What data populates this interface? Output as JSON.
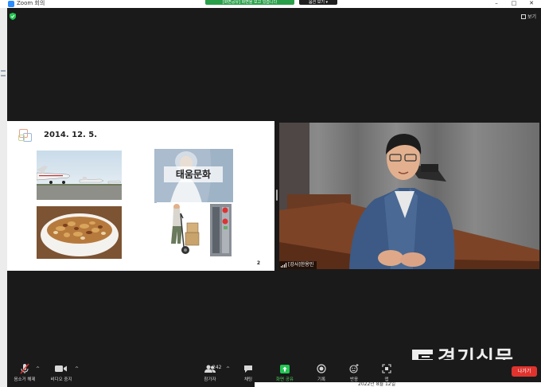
{
  "window": {
    "title": "Zoom 회의",
    "share_banner": "[화면공유] 화면을 보고 있습니다",
    "stop_share_label": "옵션 보기 ▾",
    "controls": {
      "minimize": "–",
      "maximize": "□",
      "close": "✕"
    }
  },
  "top_overlay": {
    "view_label": "보기",
    "security_icon": "shield-check-icon"
  },
  "slide": {
    "date": "2014. 12. 5.",
    "culture_caption": "태움문화",
    "page_number": "2"
  },
  "video": {
    "participant_name": "[강사]한용민"
  },
  "toolbar": {
    "mute_label": "음소거 해제",
    "video_label": "비디오 중지",
    "participants_label": "참가자",
    "participants_count": "242",
    "chat_label": "채팅",
    "share_label": "화면 공유",
    "record_label": "기록",
    "reactions_label": "반응",
    "apps_label": "앱",
    "leave_label": "나가기"
  },
  "watermark": {
    "text": "경기신문"
  },
  "bottom_strip_text": "2022년 8월 12일",
  "colors": {
    "background": "#1a1a1a",
    "share_green": "#29a049",
    "leave_red": "#e0332e",
    "zoom_blue": "#2d8cff"
  }
}
